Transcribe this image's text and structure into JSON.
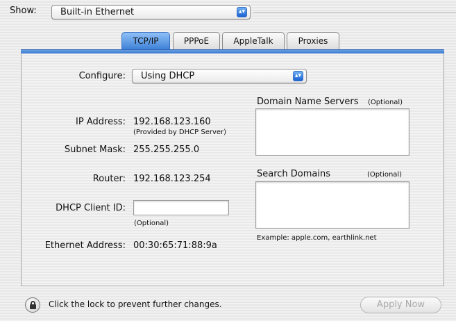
{
  "show": {
    "label": "Show:",
    "value": "Built-in Ethernet"
  },
  "tabs": [
    {
      "label": "TCP/IP",
      "active": true
    },
    {
      "label": "PPPoE",
      "active": false
    },
    {
      "label": "AppleTalk",
      "active": false
    },
    {
      "label": "Proxies",
      "active": false
    }
  ],
  "configure": {
    "label": "Configure:",
    "value": "Using DHCP"
  },
  "ip": {
    "label": "IP Address:",
    "value": "192.168.123.160",
    "note": "(Provided by DHCP Server)"
  },
  "subnet": {
    "label": "Subnet Mask:",
    "value": "255.255.255.0"
  },
  "router": {
    "label": "Router:",
    "value": "192.168.123.254"
  },
  "dhcp": {
    "label": "DHCP Client ID:",
    "value": "",
    "note": "(Optional)"
  },
  "ethernet": {
    "label": "Ethernet Address:",
    "value": "00:30:65:71:88:9a"
  },
  "dns": {
    "label": "Domain Name Servers",
    "optional": "(Optional)",
    "value": ""
  },
  "search": {
    "label": "Search Domains",
    "optional": "(Optional)",
    "value": "",
    "example": "Example: apple.com, earthlink.net"
  },
  "lock": {
    "text": "Click the lock to prevent further changes."
  },
  "apply": {
    "label": "Apply Now"
  },
  "colors": {
    "accent": "#3b7fd6",
    "disabled_text": "#a9a9a9"
  },
  "icons": {
    "lock": "lock-icon",
    "popup_arrows": "popup-arrows-icon"
  }
}
